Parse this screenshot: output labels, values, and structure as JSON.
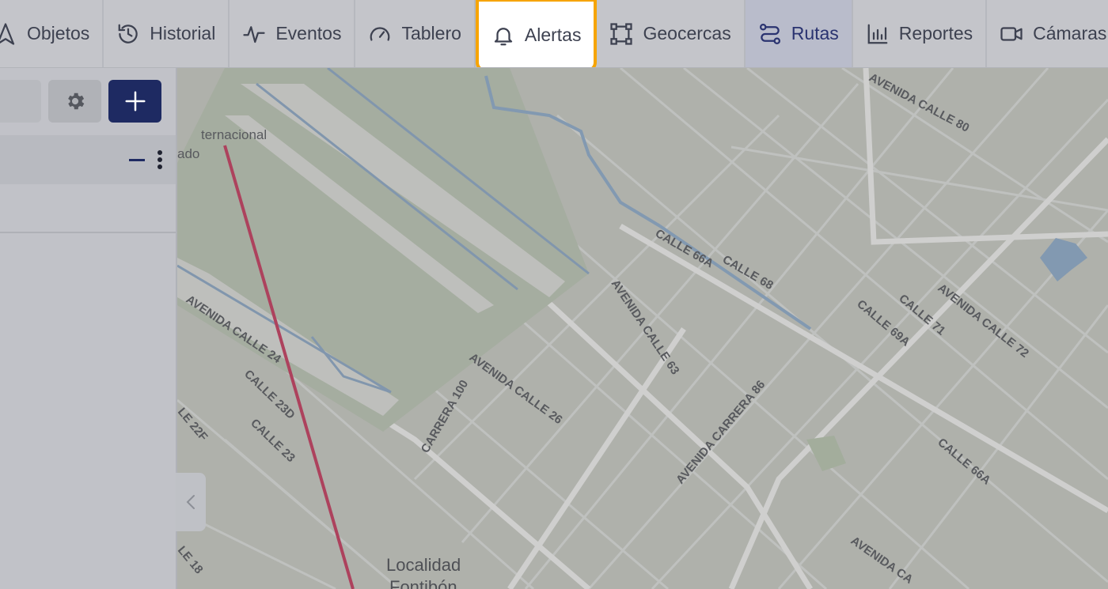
{
  "nav": {
    "tabs": [
      {
        "label": "Objetos",
        "icon": "navigation-arrow-icon"
      },
      {
        "label": "Historial",
        "icon": "history-icon"
      },
      {
        "label": "Eventos",
        "icon": "activity-pulse-icon"
      },
      {
        "label": "Tablero",
        "icon": "gauge-icon"
      },
      {
        "label": "Alertas",
        "icon": "bell-icon"
      },
      {
        "label": "Geocercas",
        "icon": "geofence-square-icon"
      },
      {
        "label": "Rutas",
        "icon": "route-icon"
      },
      {
        "label": "Reportes",
        "icon": "bar-chart-icon"
      },
      {
        "label": "Cámaras",
        "icon": "video-camera-icon"
      }
    ],
    "active_tab": "Rutas",
    "highlighted_tab": "Alertas"
  },
  "sidebar": {
    "search_placeholder": "",
    "group_row": {
      "collapse_icon": "minus-icon",
      "menu_icon": "kebab-menu-icon"
    }
  },
  "map": {
    "labels": {
      "airport_1": "ternacional",
      "airport_2": "ado",
      "c80": "AVENIDA CALLE 80",
      "c66a": "CALLE 66A",
      "c68": "CALLE 68",
      "c63": "AVENIDA CALLE 63",
      "c71": "CALLE 71",
      "c69a": "CALLE 69A",
      "c72": "AVENIDA CALLE 72",
      "c24": "AVENIDA CALLE 24",
      "c23d": "CALLE 23D",
      "c23": "CALLE 23",
      "c22f": "LE 22F",
      "cr100": "CARRERA 100",
      "c26": "AVENIDA CALLE 26",
      "cr86": "AVENIDA CARRERA 86",
      "c66a_2": "CALLE 66A",
      "c18": "LE 18",
      "av_ca": "AVENIDA CA",
      "loc_1": "Localidad",
      "loc_2": "Fontibón"
    },
    "route_color": "#b3304f"
  }
}
